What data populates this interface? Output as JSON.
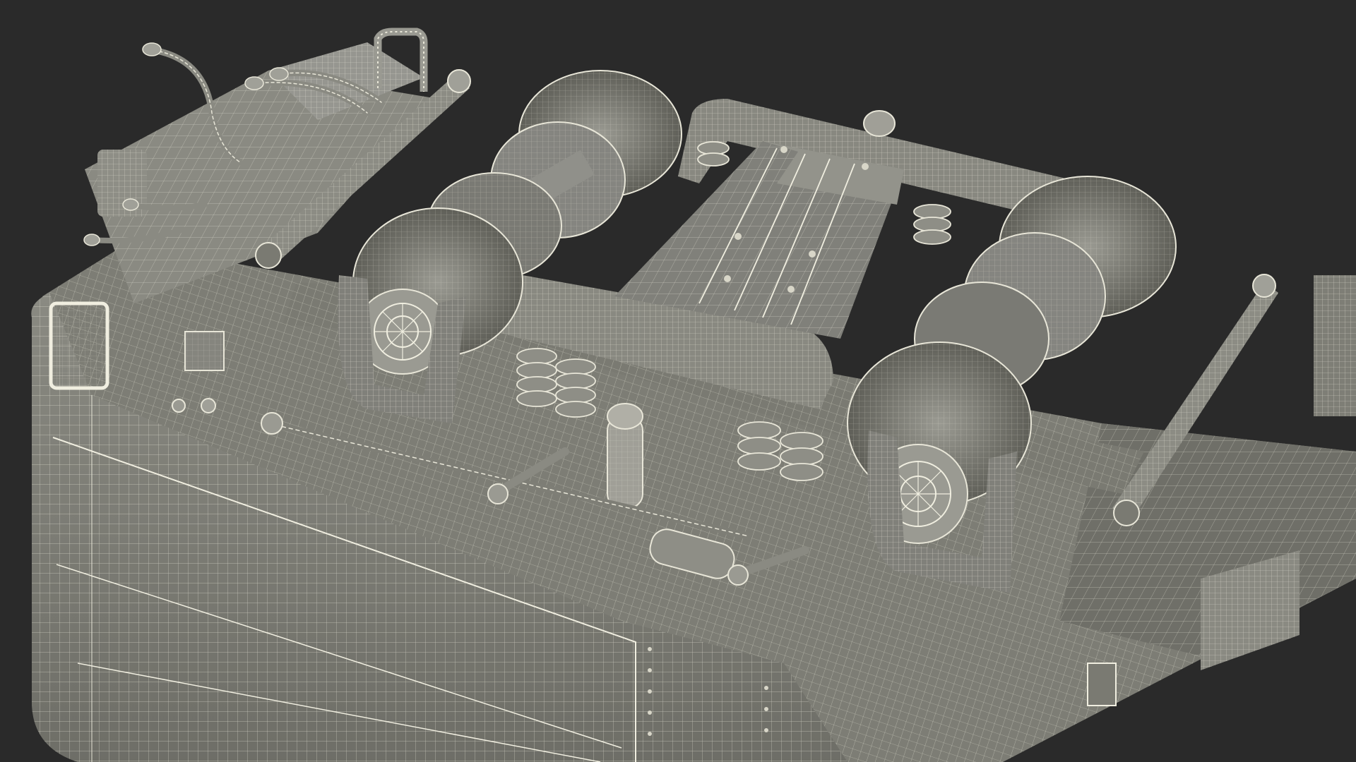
{
  "scene": {
    "subject": "wireframe-rail-bogie-undercarriage",
    "render_style": "wireframe-on-clay",
    "colors": {
      "background": "#2a2a2a",
      "surface": "#8c8c84",
      "surface_shadow": "#5e5e58",
      "surface_light": "#b4b4aa",
      "wire": "#e8e6d8",
      "wire_dim": "#c9c7b8"
    }
  }
}
